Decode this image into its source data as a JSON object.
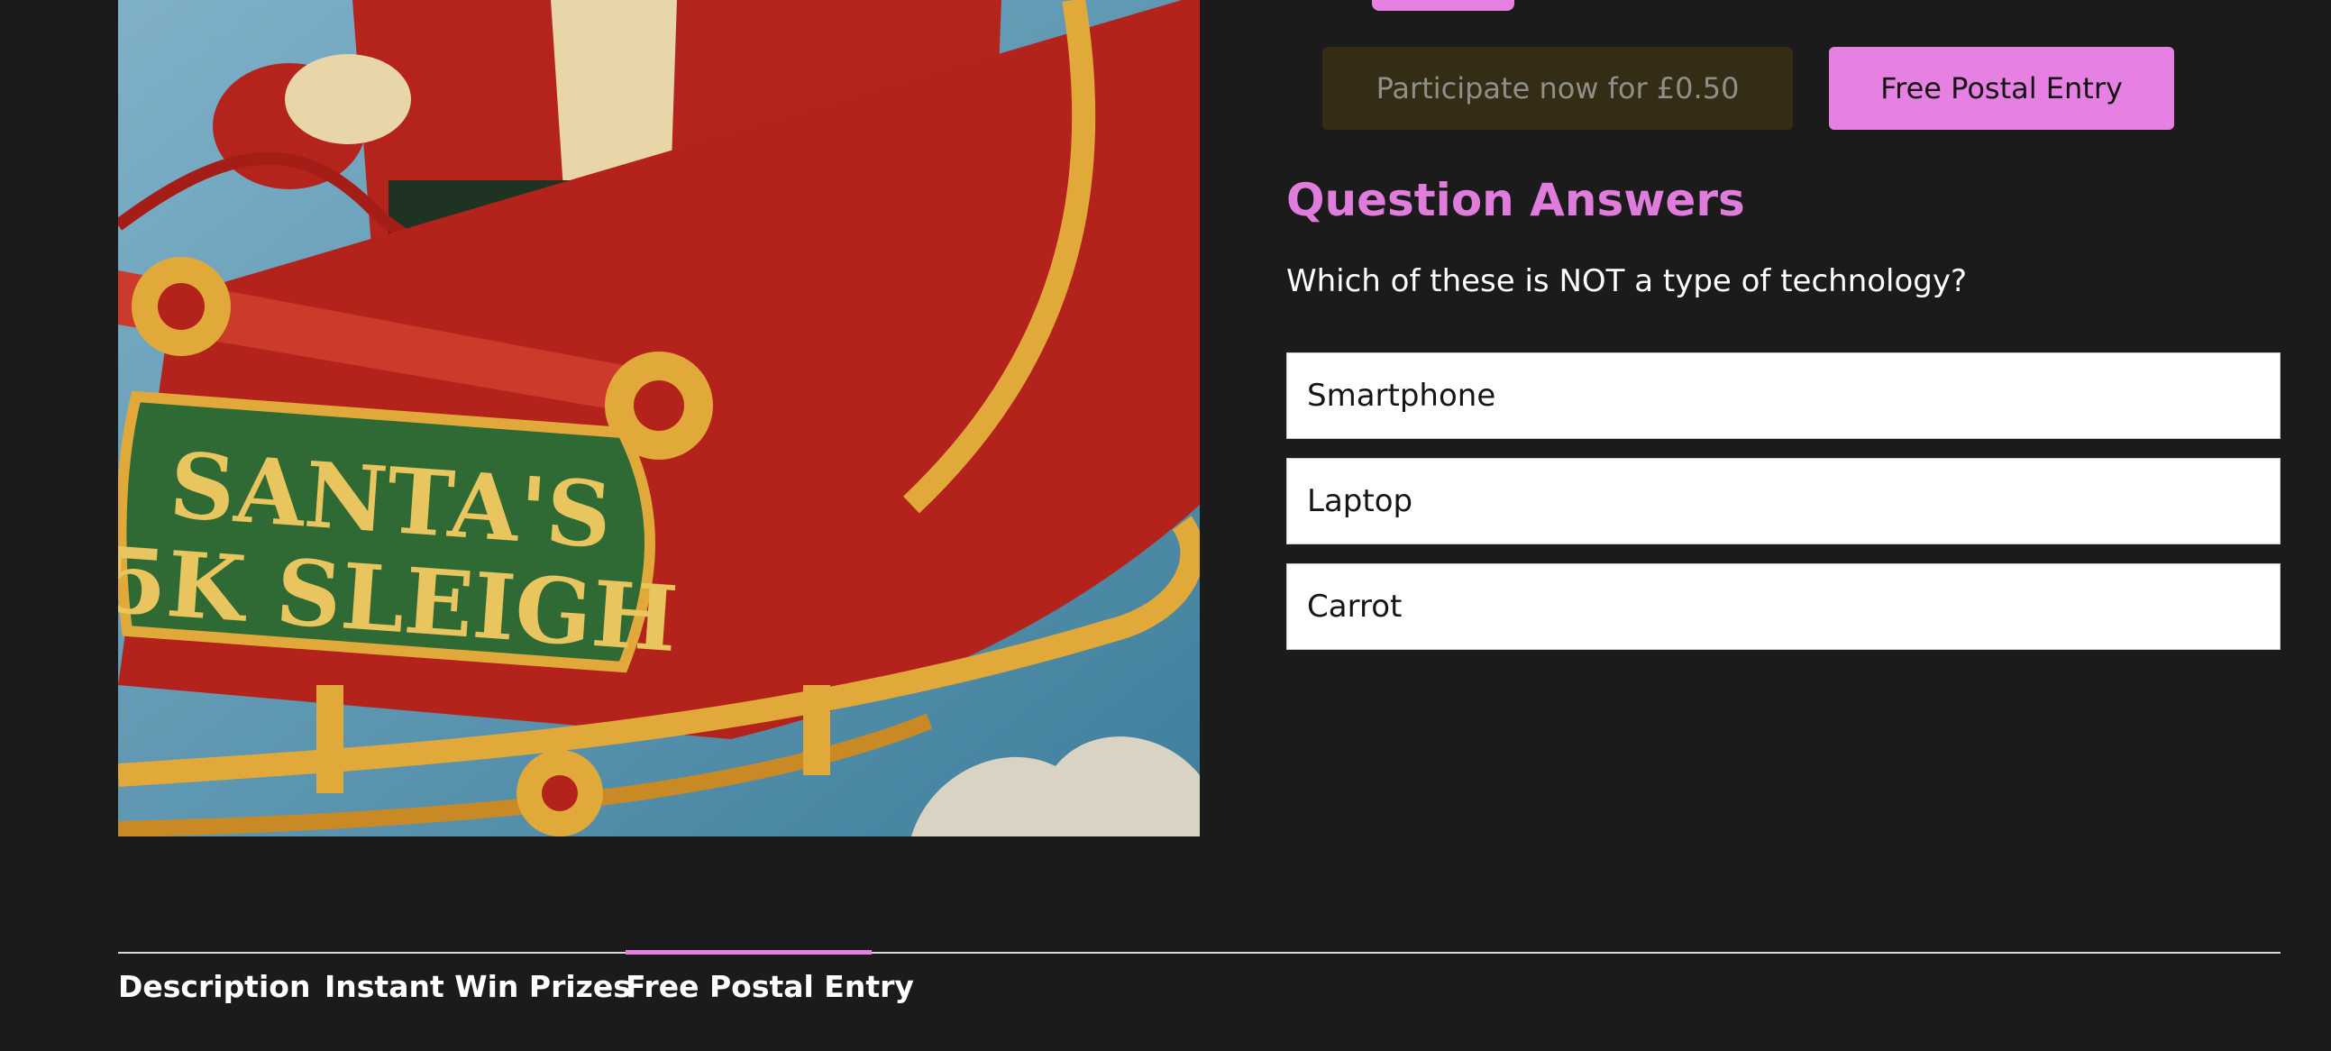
{
  "actions": {
    "participate_label": "Participate now for £0.50",
    "postal_label": "Free Postal Entry"
  },
  "qa": {
    "title": "Question Answers",
    "question": "Which of these is NOT a type of technology?",
    "answers": [
      "Smartphone",
      "Laptop",
      "Carrot"
    ]
  },
  "tabs": [
    {
      "label": "Description",
      "active": false
    },
    {
      "label": "Instant Win Prizes",
      "active": false
    },
    {
      "label": "Free Postal Entry",
      "active": true
    }
  ],
  "image": {
    "sign_line1": "SANTA'S",
    "sign_line2": "5K SLEIGH"
  },
  "colors": {
    "accent": "#e681e3",
    "background": "#1b1b1b",
    "disabled_button": "#342c14"
  }
}
